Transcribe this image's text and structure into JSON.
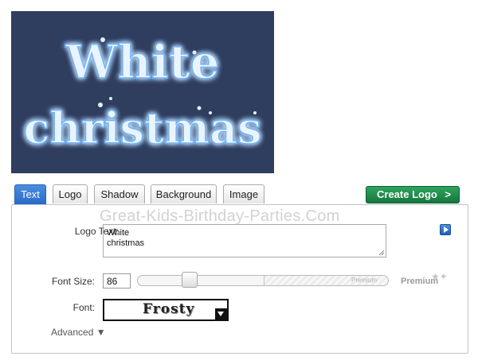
{
  "preview": {
    "logo_line1": "White",
    "logo_line2": "christmas",
    "background": "#2f3d5e",
    "text_color": "#eaf4ff",
    "glow_color": "#9fd2ff"
  },
  "tabs": [
    {
      "label": "Text",
      "active": true
    },
    {
      "label": "Logo",
      "active": false
    },
    {
      "label": "Shadow",
      "active": false
    },
    {
      "label": "Background",
      "active": false
    },
    {
      "label": "Image",
      "active": false
    }
  ],
  "create_button": {
    "label": "Create Logo",
    "arrow": ">"
  },
  "watermark": "Great-Kids-Birthday-Parties.Com",
  "logo_text": {
    "label": "Logo Text:",
    "value": "White\nchristmas"
  },
  "font_size": {
    "label": "Font Size:",
    "value": "86",
    "premium_zone_label": "Premium",
    "premium_label": "Premium"
  },
  "font": {
    "label": "Font:",
    "selected": "Frosty"
  },
  "advanced": {
    "label": "Advanced ▼"
  }
}
